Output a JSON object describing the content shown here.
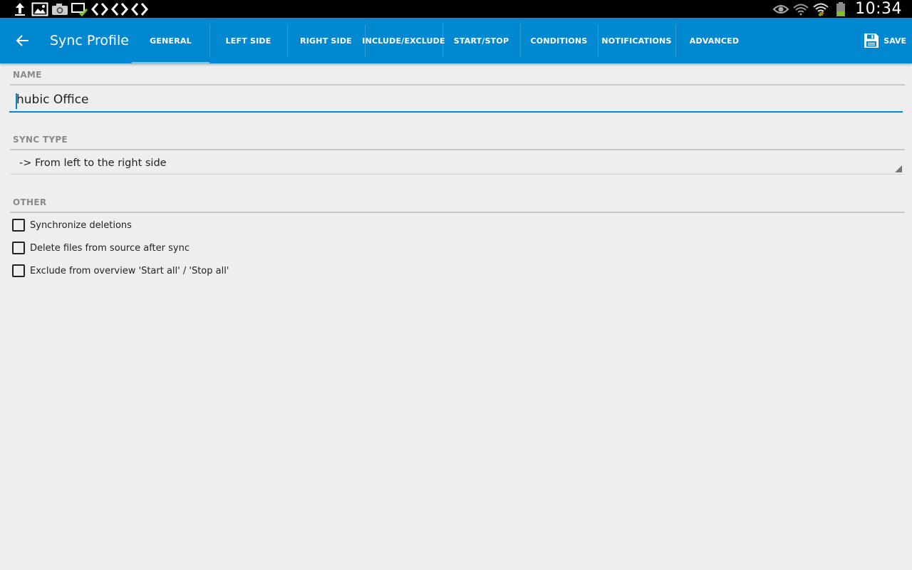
{
  "status_bar": {
    "left_icons": [
      "upload-icon",
      "image-icon",
      "camera-icon",
      "cast-check-icon",
      "sync-arrows-icon",
      "sync-arrows-icon",
      "sync-arrows-icon"
    ],
    "right_icons": [
      "eye-icon",
      "wifi-icon",
      "wifi-signal-icon",
      "battery-icon"
    ],
    "time": "10:34"
  },
  "app_bar": {
    "title": "Sync Profile",
    "tabs": [
      {
        "label": "GENERAL",
        "active": true
      },
      {
        "label": "LEFT SIDE"
      },
      {
        "label": "RIGHT SIDE"
      },
      {
        "label": "INCLUDE/EXCLUDE"
      },
      {
        "label": "START/STOP"
      },
      {
        "label": "CONDITIONS"
      },
      {
        "label": "NOTIFICATIONS"
      },
      {
        "label": "ADVANCED"
      }
    ],
    "save_label": "SAVE",
    "colors": {
      "primary": "#0288d1",
      "status_bar": "#000000"
    }
  },
  "form": {
    "name_header": "NAME",
    "name_value": "hubic Office",
    "sync_type_header": "SYNC TYPE",
    "sync_type_value": "-> From left to the right side",
    "other_header": "OTHER",
    "options": [
      {
        "label": "Synchronize deletions",
        "checked": false
      },
      {
        "label": "Delete files from source after sync",
        "checked": false
      },
      {
        "label": "Exclude from overview 'Start all' / 'Stop all'",
        "checked": false
      }
    ]
  }
}
